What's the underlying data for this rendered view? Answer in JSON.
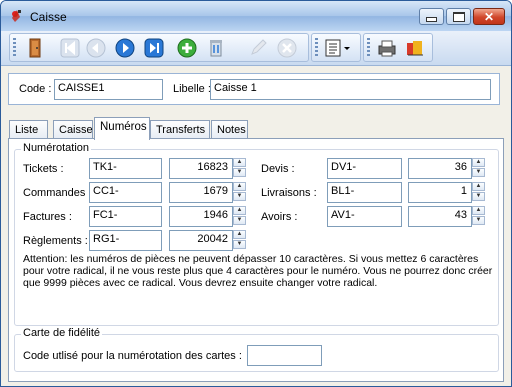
{
  "window": {
    "title": "Caisse"
  },
  "header": {
    "code_label": "Code :",
    "code_value": "CAISSE1",
    "libelle_label": "Libelle :",
    "libelle_value": "Caisse 1"
  },
  "tabs": [
    {
      "label": "Liste",
      "active": false
    },
    {
      "label": "Caisse",
      "active": false
    },
    {
      "label": "Numéros",
      "active": true
    },
    {
      "label": "Transferts",
      "active": false
    },
    {
      "label": "Notes",
      "active": false
    }
  ],
  "numerotation": {
    "legend": "Numérotation",
    "rows_left": [
      {
        "label": "Tickets :",
        "prefix": "TK1-",
        "number": "16823"
      },
      {
        "label": "Commandes :",
        "prefix": "CC1-",
        "number": "1679"
      },
      {
        "label": "Factures :",
        "prefix": "FC1-",
        "number": "1946"
      },
      {
        "label": "Règlements :",
        "prefix": "RG1-",
        "number": "20042"
      }
    ],
    "rows_right": [
      {
        "label": "Devis :",
        "prefix": "DV1-",
        "number": "36"
      },
      {
        "label": "Livraisons :",
        "prefix": "BL1-",
        "number": "1"
      },
      {
        "label": "Avoirs :",
        "prefix": "AV1-",
        "number": "43"
      }
    ],
    "note": "Attention: les numéros de pièces ne peuvent dépasser 10 caractères. Si vous mettez 6 caractères pour votre radical, il ne vous reste plus que 4 caractères pour le numéro. Vous ne pourrez donc créer que 9999 pièces avec ce radical. Vous devrez ensuite changer votre radical."
  },
  "fidelite": {
    "legend": "Carte de fidélité",
    "label": "Code utlisé pour la numérotation des cartes :",
    "value": ""
  },
  "toolbar": {
    "icons": [
      "door-exit-icon",
      "first-record-icon",
      "previous-record-icon",
      "next-record-icon",
      "last-record-icon",
      "add-icon",
      "delete-icon",
      "edit-icon",
      "cancel-icon",
      "view-menu-icon",
      "print-icon",
      "export-icon"
    ]
  },
  "colors": {
    "title_bar": "#a8c6ea",
    "close_button": "#d0462a",
    "active_tab": "#ffffff"
  }
}
